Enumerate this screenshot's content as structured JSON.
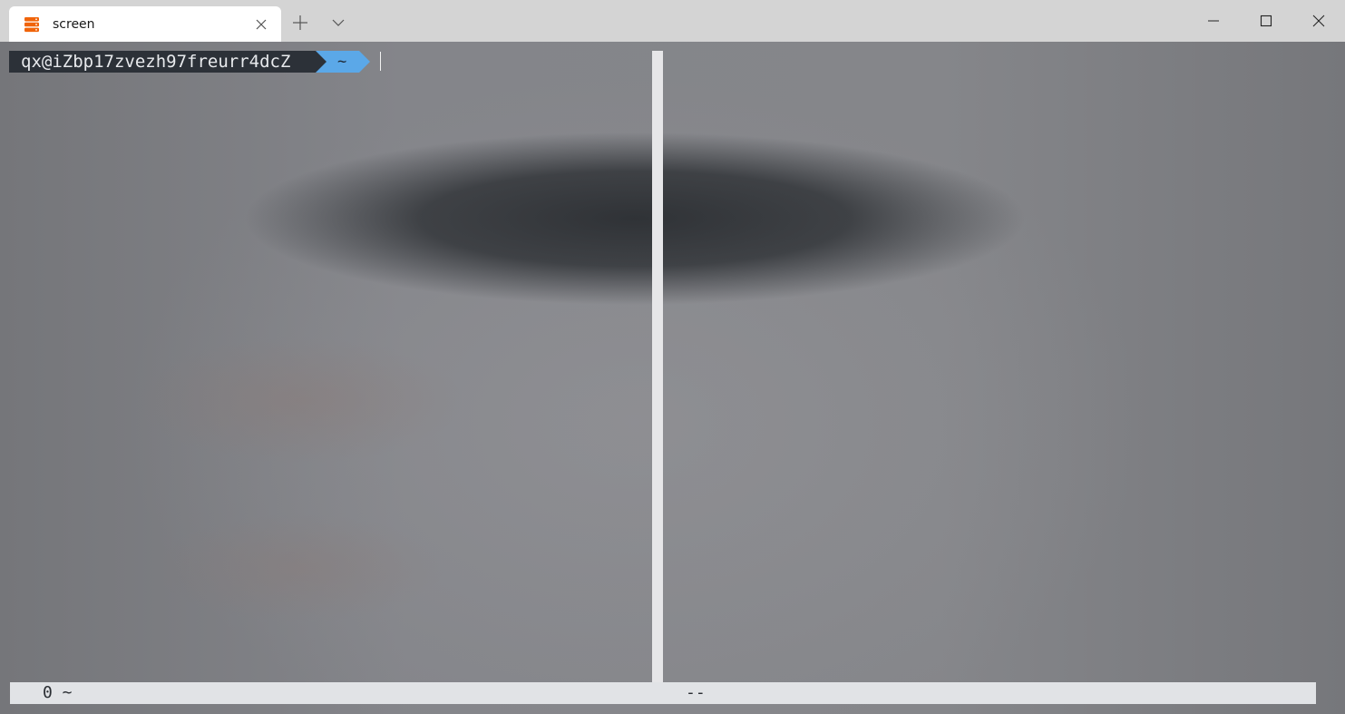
{
  "titlebar": {
    "tab": {
      "title": "screen",
      "icon": "server-stack-icon",
      "icon_color": "#f0640a"
    },
    "new_tab_icon": "plus-icon",
    "dropdown_icon": "chevron-down-icon",
    "window_controls": [
      "minimize-icon",
      "maximize-icon",
      "close-icon"
    ]
  },
  "terminal": {
    "prompt": {
      "user_host": "qx@iZbp17zvezh97freurr4dcZ",
      "directory": "~",
      "user_segment_color": "#2c3138",
      "dir_segment_color": "#5ba8e8"
    },
    "statusbar": {
      "left": "0 ~",
      "center": "--"
    }
  }
}
